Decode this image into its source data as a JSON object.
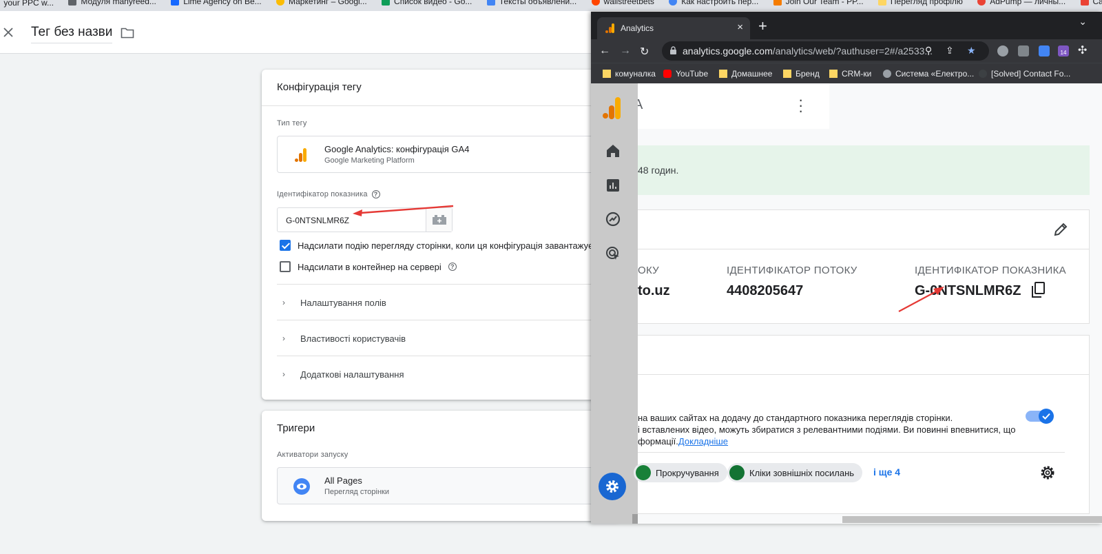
{
  "top_strip": {
    "bookmarks": [
      "your PPC w...",
      "Модуля manyreed...",
      "Lime Agency on Be...",
      "Маркетинг – Googl...",
      "Список видео - Go...",
      "Тексты объявлени...",
      "wallstreetbets",
      "Как настроить пер...",
      "Join Our Team - PP...",
      "Перегляд профілю",
      "AdPump — личны...",
      "Career Centre"
    ]
  },
  "gtm": {
    "title": "Тег без назви",
    "config_card": {
      "title": "Конфігурація тегу",
      "tag_type_label": "Тип тегу",
      "tag_type_name": "Google Analytics: конфігурація GA4",
      "tag_type_sub": "Google Marketing Platform",
      "measurement_label": "Ідентифікатор показника",
      "measurement_value": "G-0NTSNLMR6Z",
      "checkbox_pageview": "Надсилати подію перегляду сторінки, коли ця конфігурація завантажується",
      "checkbox_server": "Надсилати в контейнер на сервері",
      "expanders": [
        "Налаштування полів",
        "Властивості користувачів",
        "Додаткові налаштування"
      ]
    },
    "triggers_card": {
      "title": "Тригери",
      "firing_label": "Активатори запуску",
      "trigger_name": "All Pages",
      "trigger_sub": "Перегляд сторінки"
    }
  },
  "analytics_window": {
    "tab_title": "Analytics",
    "url_host": "analytics.google.com",
    "url_path": "/analytics/web/?authuser=2#/a2533...",
    "ext_badge": "14",
    "bookmarks": [
      "комуналка",
      "YouTube",
      "Домашнее",
      "Бренд",
      "CRM-ки",
      "Система «Електро...",
      "[Solved] Contact Fo..."
    ],
    "banner_text": "48 годин.",
    "stream": {
      "col1_label": "ОКУ",
      "col1_value": "to.uz",
      "col2_label": "ІДЕНТИФІКАТОР ПОТОКУ",
      "col2_value": "4408205647",
      "col3_label": "ІДЕНТИФІКАТОР ПОКАЗНИКА",
      "col3_value": "G-0NTSNLMR6Z"
    },
    "enhanced": {
      "line1": "на ваших сайтах на додачу до стандартного показника переглядів сторінки.",
      "line2": "і вставлених відео, можуть збиратися з релевантними подіями. Ви повинні впевнитися, що",
      "line3": "формації.",
      "link": "Докладніше",
      "toggle_on": true,
      "chips": [
        "Прокручування",
        "Кліки зовнішніх посилань"
      ],
      "more": "і ще 4"
    }
  },
  "colors": {
    "accent": "#1a73e8",
    "ga_orange": "#f9ab00",
    "ga_dark_orange": "#e37400",
    "arrow_red": "#e53935"
  }
}
